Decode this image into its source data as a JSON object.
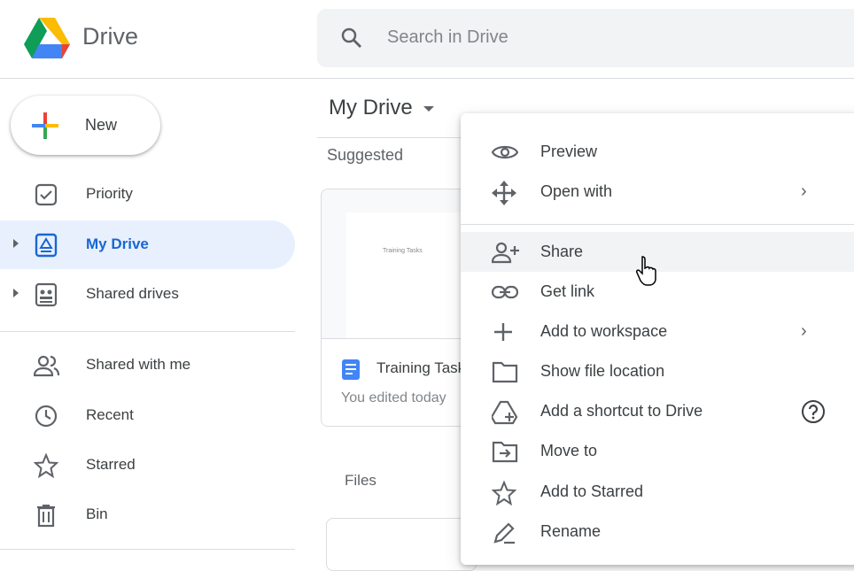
{
  "header": {
    "brand": "Drive",
    "search_placeholder": "Search in Drive"
  },
  "sidebar": {
    "new_label": "New",
    "items": [
      {
        "label": "Priority",
        "icon": "priority-icon"
      },
      {
        "label": "My Drive",
        "icon": "my-drive-icon",
        "active": true
      },
      {
        "label": "Shared drives",
        "icon": "shared-drives-icon"
      },
      {
        "label": "Shared with me",
        "icon": "people-icon"
      },
      {
        "label": "Recent",
        "icon": "clock-icon"
      },
      {
        "label": "Starred",
        "icon": "star-icon"
      },
      {
        "label": "Bin",
        "icon": "trash-icon"
      }
    ]
  },
  "main": {
    "title": "My Drive",
    "suggested": "Suggested",
    "card": {
      "thumb_text": "Training Tasks",
      "name": "Training Tasks",
      "subtitle": "You edited today"
    },
    "files": "Files"
  },
  "menu": {
    "items": [
      {
        "label": "Preview"
      },
      {
        "label": "Open with"
      },
      {
        "label": "Share"
      },
      {
        "label": "Get link"
      },
      {
        "label": "Add to workspace"
      },
      {
        "label": "Show file location"
      },
      {
        "label": "Add a shortcut to Drive"
      },
      {
        "label": "Move to"
      },
      {
        "label": "Add to Starred"
      },
      {
        "label": "Rename"
      }
    ],
    "chevron": "›"
  },
  "colors": {
    "accent": "#1967d2",
    "active_bg": "#e8f0fe"
  }
}
